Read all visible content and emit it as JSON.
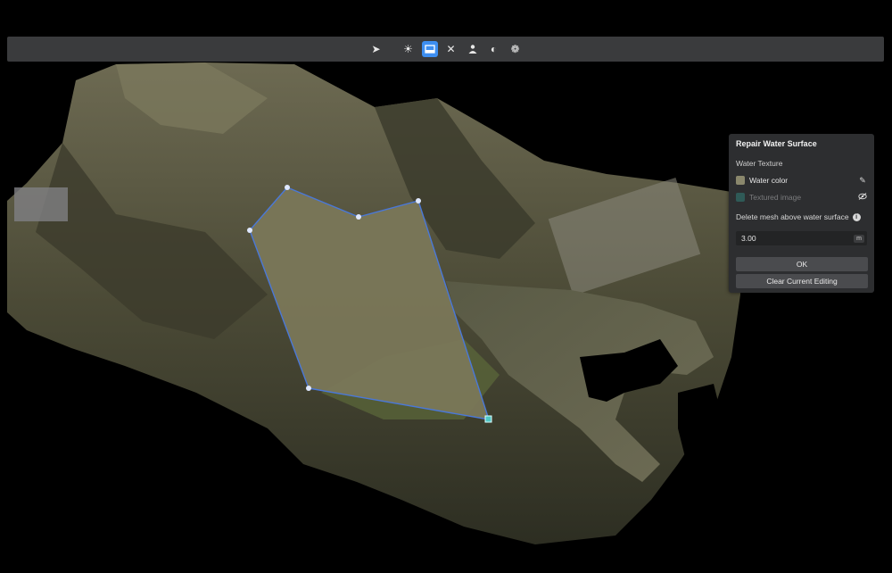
{
  "toolbar": {
    "icons": [
      "select-arrow-icon",
      "sun-icon",
      "water-surface-icon",
      "close-icon",
      "person-icon",
      "shading-icon",
      "model-icon"
    ],
    "active_tool": "water-surface-icon",
    "accent_color": "#3d8ef0"
  },
  "panel": {
    "title": "Repair Water Surface",
    "section_label": "Water Texture",
    "options": [
      {
        "label": "Water color",
        "swatch": "#8a876c",
        "icon": "pencil-icon"
      },
      {
        "label": "Textured image",
        "swatch": "#2f5a57",
        "icon": "eye-off-icon"
      }
    ],
    "delete_label": "Delete mesh above water surface",
    "height_value": "3.00",
    "unit": "m",
    "ok_label": "OK",
    "clear_label": "Clear Current Editing"
  },
  "selection": {
    "fill_color": "#7a7758",
    "edge_color": "#4a78d8"
  }
}
